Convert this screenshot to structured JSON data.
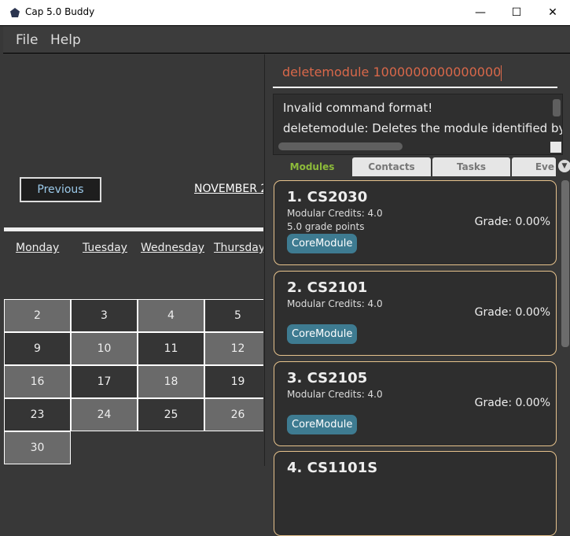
{
  "window": {
    "title": "Cap 5.0 Buddy",
    "minimize": "—",
    "maximize": "☐",
    "close": "✕"
  },
  "menu": [
    "File",
    "Help"
  ],
  "calendar": {
    "previous_label": "Previous",
    "month_label": "NOVEMBER 2",
    "days": [
      "Monday",
      "Tuesday",
      "Wednesday",
      "Thursday"
    ],
    "rows": [
      [
        "2",
        "3",
        "4",
        "5"
      ],
      [
        "9",
        "10",
        "11",
        "12"
      ],
      [
        "16",
        "17",
        "18",
        "19"
      ],
      [
        "23",
        "24",
        "25",
        "26"
      ],
      [
        "30"
      ]
    ]
  },
  "command": {
    "value": "deletemodule 1000000000000000"
  },
  "result": {
    "lines": [
      "Invalid command format!",
      "deletemodule: Deletes the module identified by"
    ]
  },
  "tabs": [
    "Modules",
    "Contacts",
    "Tasks",
    "Eve"
  ],
  "modules": [
    {
      "title": "1.  CS2030",
      "credits": "Modular Credits: 4.0",
      "points": "5.0 grade points",
      "grade": "Grade: 0.00%",
      "tag": "CoreModule"
    },
    {
      "title": "2.  CS2101",
      "credits": "Modular Credits: 4.0",
      "points": "",
      "grade": "Grade: 0.00%",
      "tag": "CoreModule"
    },
    {
      "title": "3.  CS2105",
      "credits": "Modular Credits: 4.0",
      "points": "",
      "grade": "Grade: 0.00%",
      "tag": "CoreModule"
    },
    {
      "title": "4.  CS1101S"
    }
  ],
  "colors": {
    "accent_tab": "#8dbb3a",
    "command_text": "#d9684a",
    "tag": "#3e7b91",
    "card_border": "#e6c28c"
  }
}
